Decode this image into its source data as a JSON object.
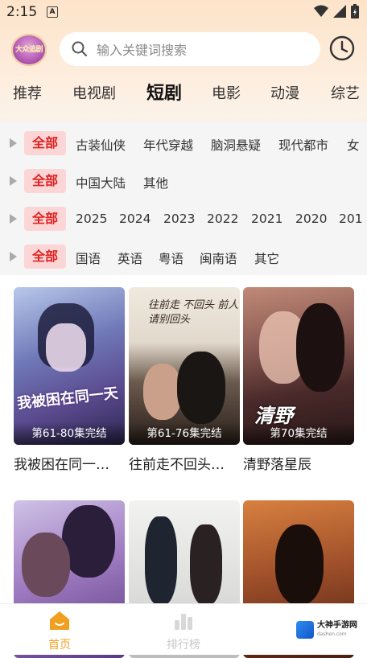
{
  "status_bar": {
    "time": "2:15",
    "notification_icon": "a-icon",
    "icons": [
      "wifi-icon",
      "signal-icon",
      "battery-icon"
    ]
  },
  "header": {
    "logo_text": "大众追剧",
    "search_placeholder": "输入关键词搜索",
    "history_icon": "clock-icon"
  },
  "tabs": [
    {
      "label": "推荐",
      "active": false
    },
    {
      "label": "电视剧",
      "active": false
    },
    {
      "label": "短剧",
      "active": true
    },
    {
      "label": "电影",
      "active": false
    },
    {
      "label": "动漫",
      "active": false
    },
    {
      "label": "综艺",
      "active": false
    }
  ],
  "filters": [
    {
      "selected": "全部",
      "options": [
        "古装仙侠",
        "年代穿越",
        "脑洞悬疑",
        "现代都市",
        "女"
      ]
    },
    {
      "selected": "全部",
      "options": [
        "中国大陆",
        "其他"
      ]
    },
    {
      "selected": "全部",
      "options": [
        "2025",
        "2024",
        "2023",
        "2022",
        "2021",
        "2020",
        "201"
      ]
    },
    {
      "selected": "全部",
      "options": [
        "国语",
        "英语",
        "粤语",
        "闽南语",
        "其它"
      ]
    }
  ],
  "cards": [
    {
      "title": "我被困在同一…",
      "episodes": "第61-80集完结",
      "overlay": "我被困在同一天"
    },
    {
      "title": "往前走不回头…",
      "episodes": "第61-76集完结",
      "overlay": "往前走 不回头 前人请别回头"
    },
    {
      "title": "清野落星辰",
      "episodes": "第70集完结",
      "overlay": "清野"
    },
    {
      "title": "",
      "episodes": "",
      "overlay": ""
    },
    {
      "title": "",
      "episodes": "",
      "overlay": ""
    },
    {
      "title": "",
      "episodes": "",
      "overlay": ""
    }
  ],
  "bottom_nav": [
    {
      "label": "首页",
      "icon": "home-icon",
      "active": true
    },
    {
      "label": "排行榜",
      "icon": "ranking-icon",
      "active": false
    }
  ],
  "watermark": {
    "name": "大神手游网",
    "url": "dashen.com"
  },
  "colors": {
    "accent": "#f0a020",
    "filter_selected_bg": "#fcd6d6",
    "filter_selected_text": "#e02020",
    "tab_underline": "#f7c98a"
  }
}
